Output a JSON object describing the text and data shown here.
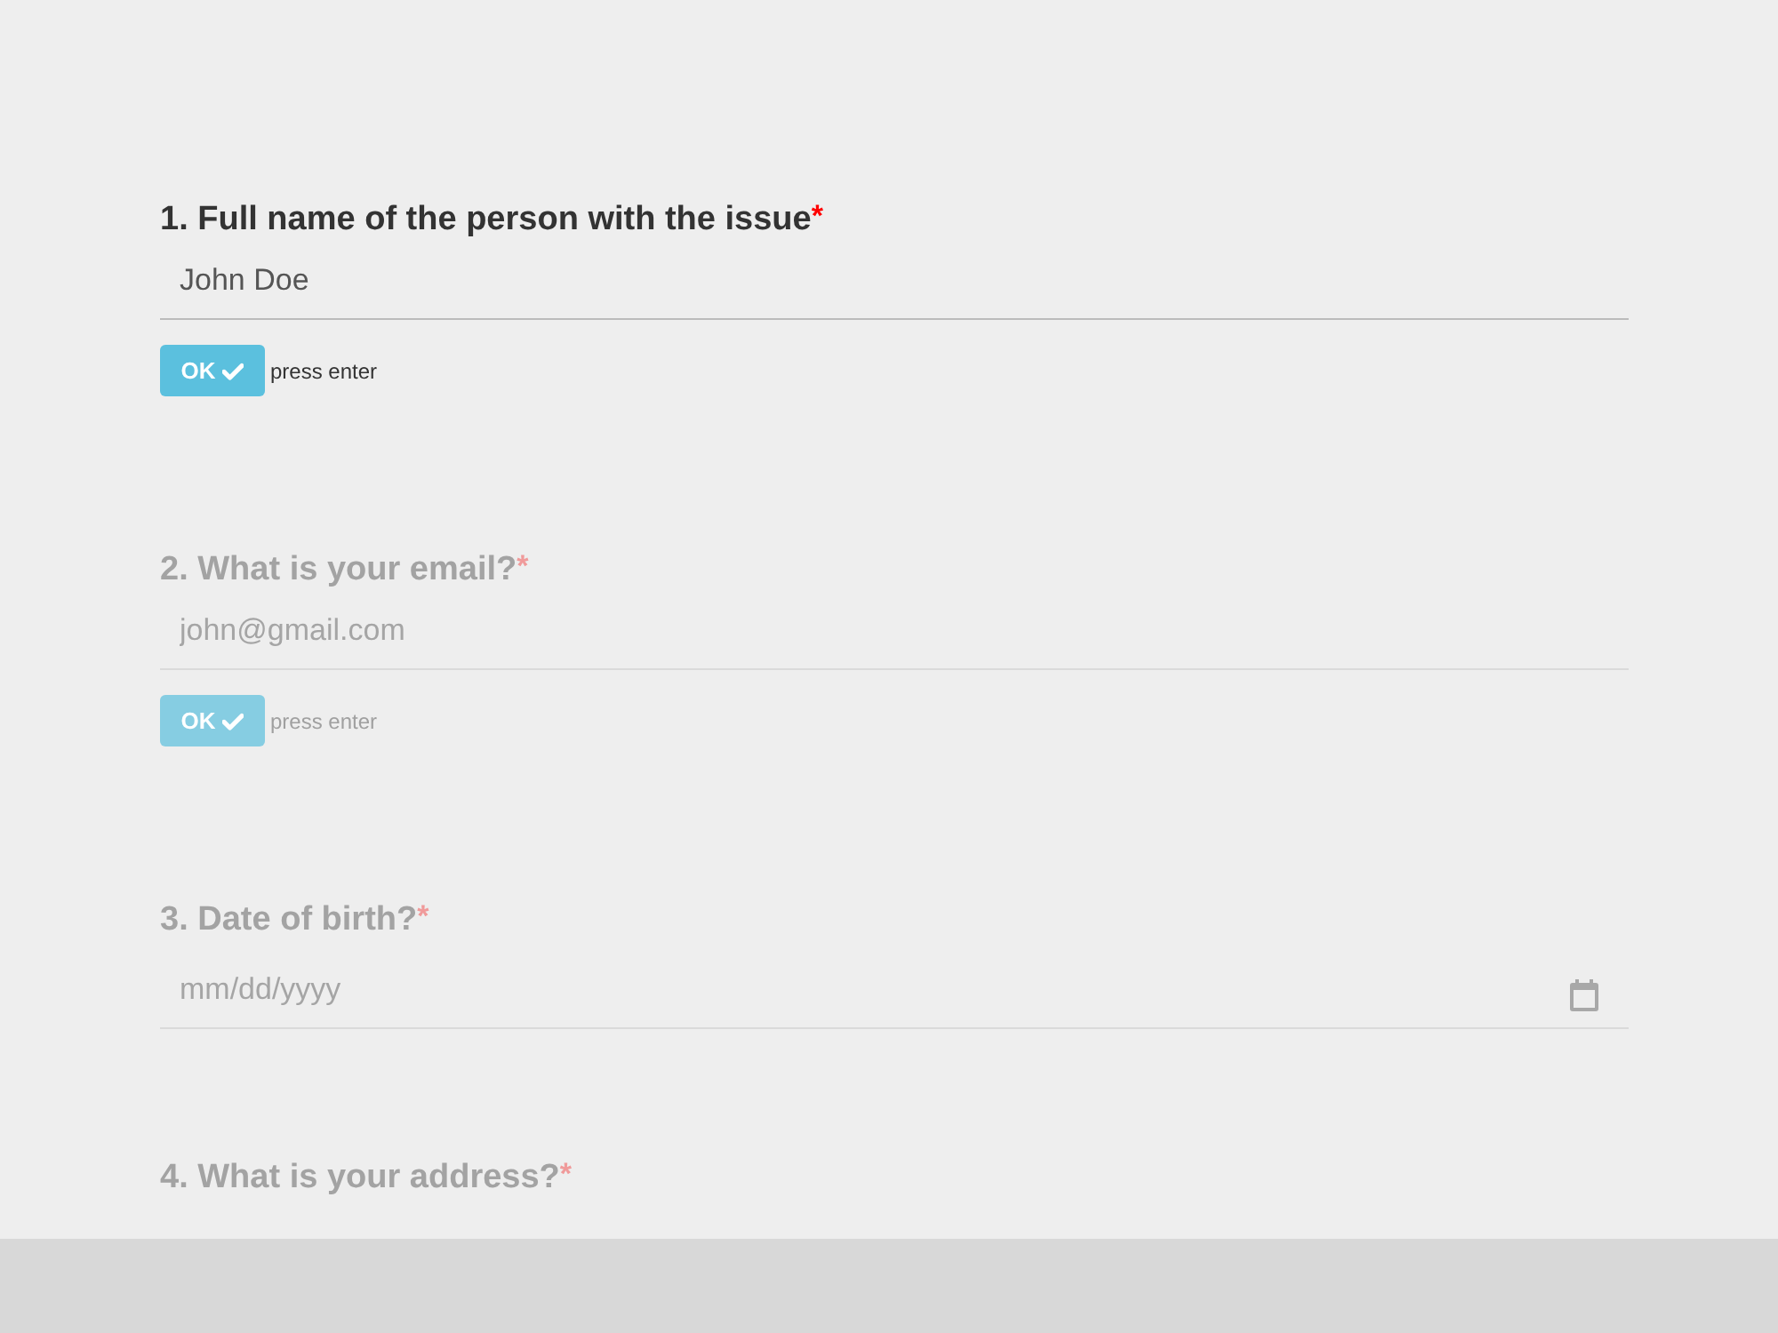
{
  "questions": [
    {
      "label": "1. Full name of the person with the issue",
      "required_mark": "*",
      "active": true,
      "field": {
        "kind": "text",
        "value": "John Doe"
      },
      "ok_button": {
        "label": "OK",
        "hint": "press enter"
      }
    },
    {
      "label": "2. What is your email?",
      "required_mark": "*",
      "active": false,
      "field": {
        "kind": "text",
        "placeholder": "john@gmail.com"
      },
      "ok_button": {
        "label": "OK",
        "hint": "press enter"
      }
    },
    {
      "label": "3. Date of birth?",
      "required_mark": "*",
      "active": false,
      "field": {
        "kind": "date",
        "placeholder": "mm/dd/yyyy"
      }
    },
    {
      "label": "4. What is your address?",
      "required_mark": "*",
      "active": false
    }
  ]
}
